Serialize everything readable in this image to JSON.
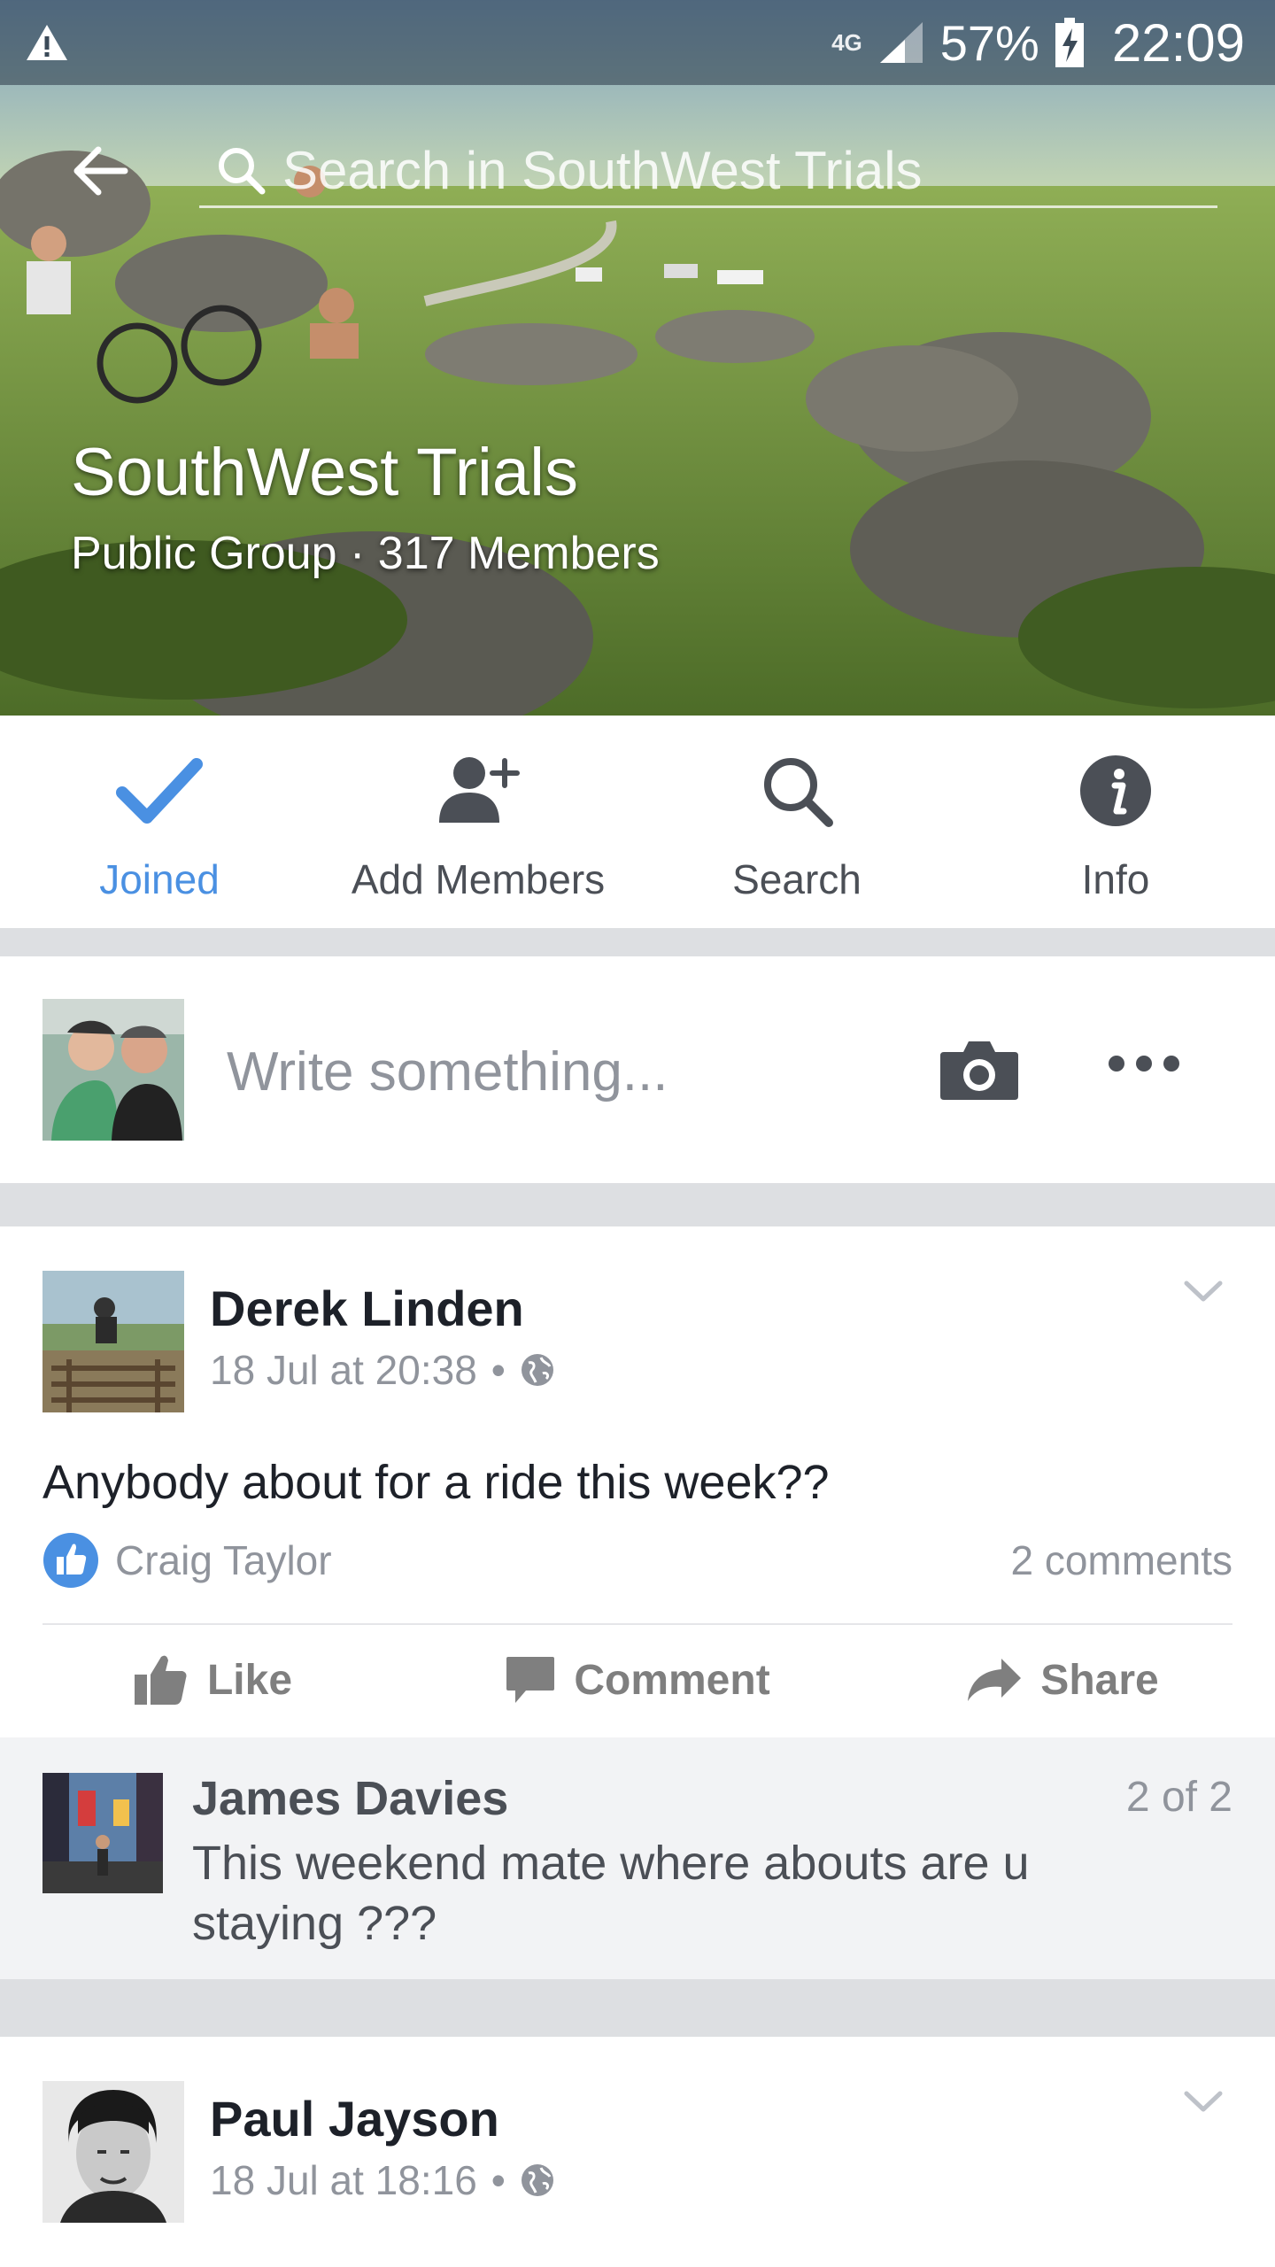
{
  "status_bar": {
    "network": "4G",
    "battery": "57%",
    "time": "22:09"
  },
  "search": {
    "placeholder": "Search in SouthWest Trials"
  },
  "group": {
    "name": "SouthWest Trials",
    "subtitle": "Public Group · 317 Members"
  },
  "actions": [
    {
      "label": "Joined"
    },
    {
      "label": "Add Members"
    },
    {
      "label": "Search"
    },
    {
      "label": "Info"
    }
  ],
  "composer": {
    "placeholder": "Write something..."
  },
  "posts": [
    {
      "author": "Derek Linden",
      "timestamp": "18 Jul at 20:38",
      "text": "Anybody about for a ride this week??",
      "liked_by": "Craig Taylor",
      "comments_count": "2 comments",
      "buttons": {
        "like": "Like",
        "comment": "Comment",
        "share": "Share"
      },
      "comment": {
        "author": "James Davies",
        "position": "2 of 2",
        "text": "This weekend mate where abouts are u staying ???"
      }
    },
    {
      "author": "Paul Jayson",
      "timestamp": "18 Jul at 18:16"
    }
  ],
  "colors": {
    "accent": "#4a90e2",
    "icon_gray": "#4b4f56",
    "meta_gray": "#90949c"
  }
}
